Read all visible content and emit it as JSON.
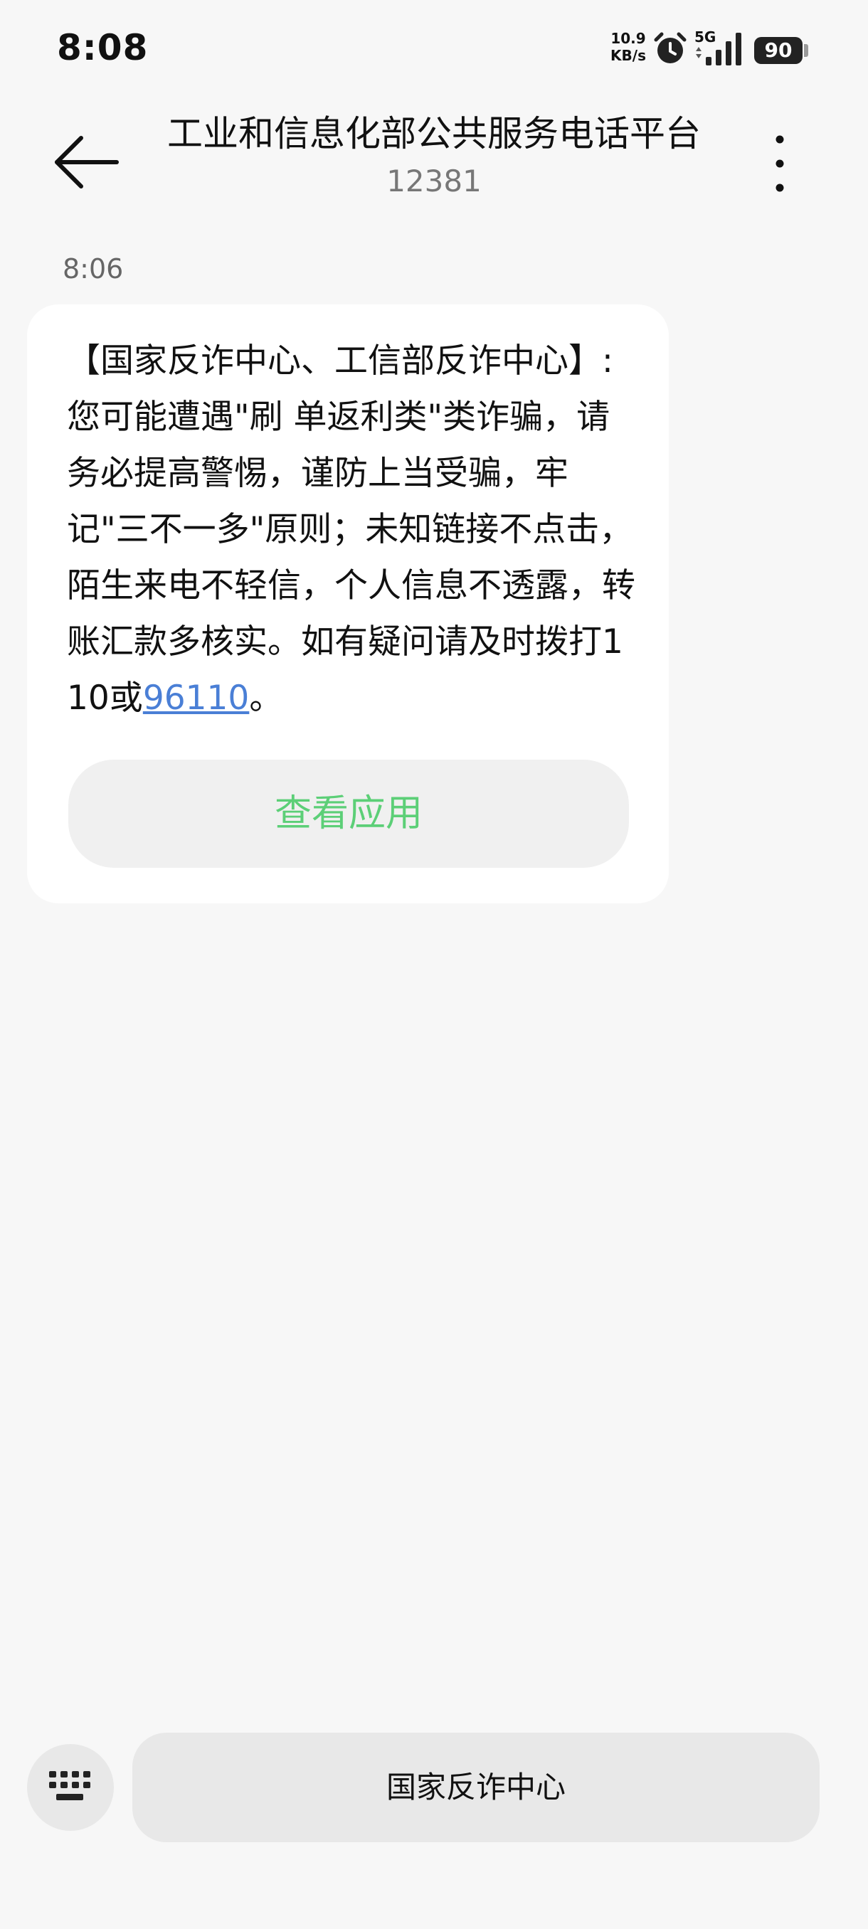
{
  "status_bar": {
    "time": "8:08",
    "net_speed_value": "10.9",
    "net_speed_unit": "KB/s",
    "network_type": "5G",
    "battery_level": "90",
    "icons": [
      "alarm-icon",
      "signal-icon",
      "battery-icon"
    ]
  },
  "header": {
    "title": "工业和信息化部公共服务电话平台",
    "number": "12381",
    "icons": [
      "back-arrow-icon",
      "more-vertical-icon"
    ]
  },
  "conversation": {
    "messages": [
      {
        "time": "8:06",
        "text_before_link": "【国家反诈中心、工信部反诈中心】: 您可能遭遇\"刷 单返利类\"类诈骗，请务必提高警惕，谨防上当受骗，牢记\"三不一多\"原则；未知链接不点击，陌生来电不轻信，个人信息不透露，转账汇款多核实。如有疑问请及时拨打110或",
        "link_text": "96110",
        "text_after_link": "。",
        "action_button_label": "查看应用"
      }
    ]
  },
  "bottom_bar": {
    "keyboard_icon": "keyboard-icon",
    "menu_button_label": "国家反诈中心"
  },
  "colors": {
    "background": "#f7f7f7",
    "bubble": "#ffffff",
    "link": "#4a7fd6",
    "action_button_text": "#5ccf77",
    "button_background": "#f0f0f0"
  }
}
